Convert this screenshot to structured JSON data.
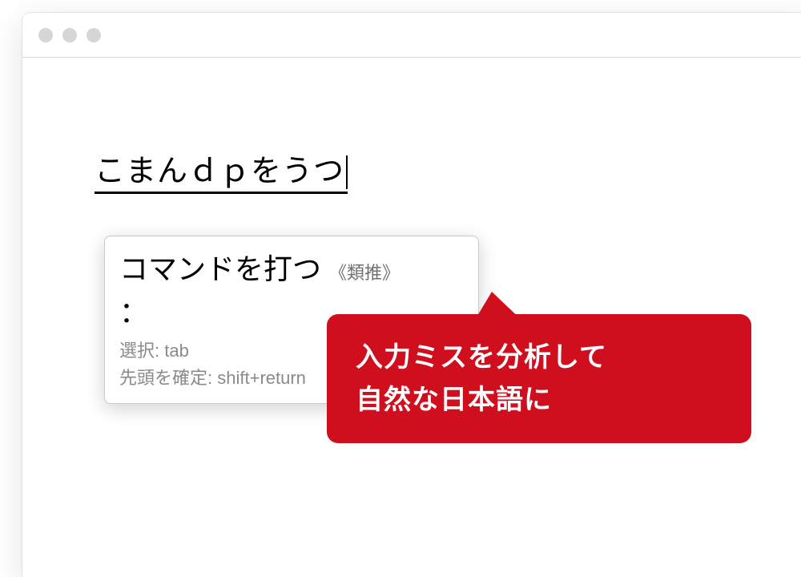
{
  "ime": {
    "input_text": "こまんｄｐをうつ",
    "candidate_main": "コマンドを打つ",
    "candidate_tag": "《類推》",
    "candidate_second": "：",
    "hint_select_label": "選択",
    "hint_select_key": "tab",
    "hint_confirm_label": "先頭を確定",
    "hint_confirm_key": "shift+return"
  },
  "callout": {
    "line1": "入力ミスを分析して",
    "line2": "自然な日本語に"
  },
  "colors": {
    "accent_red": "#cf0f1e"
  }
}
